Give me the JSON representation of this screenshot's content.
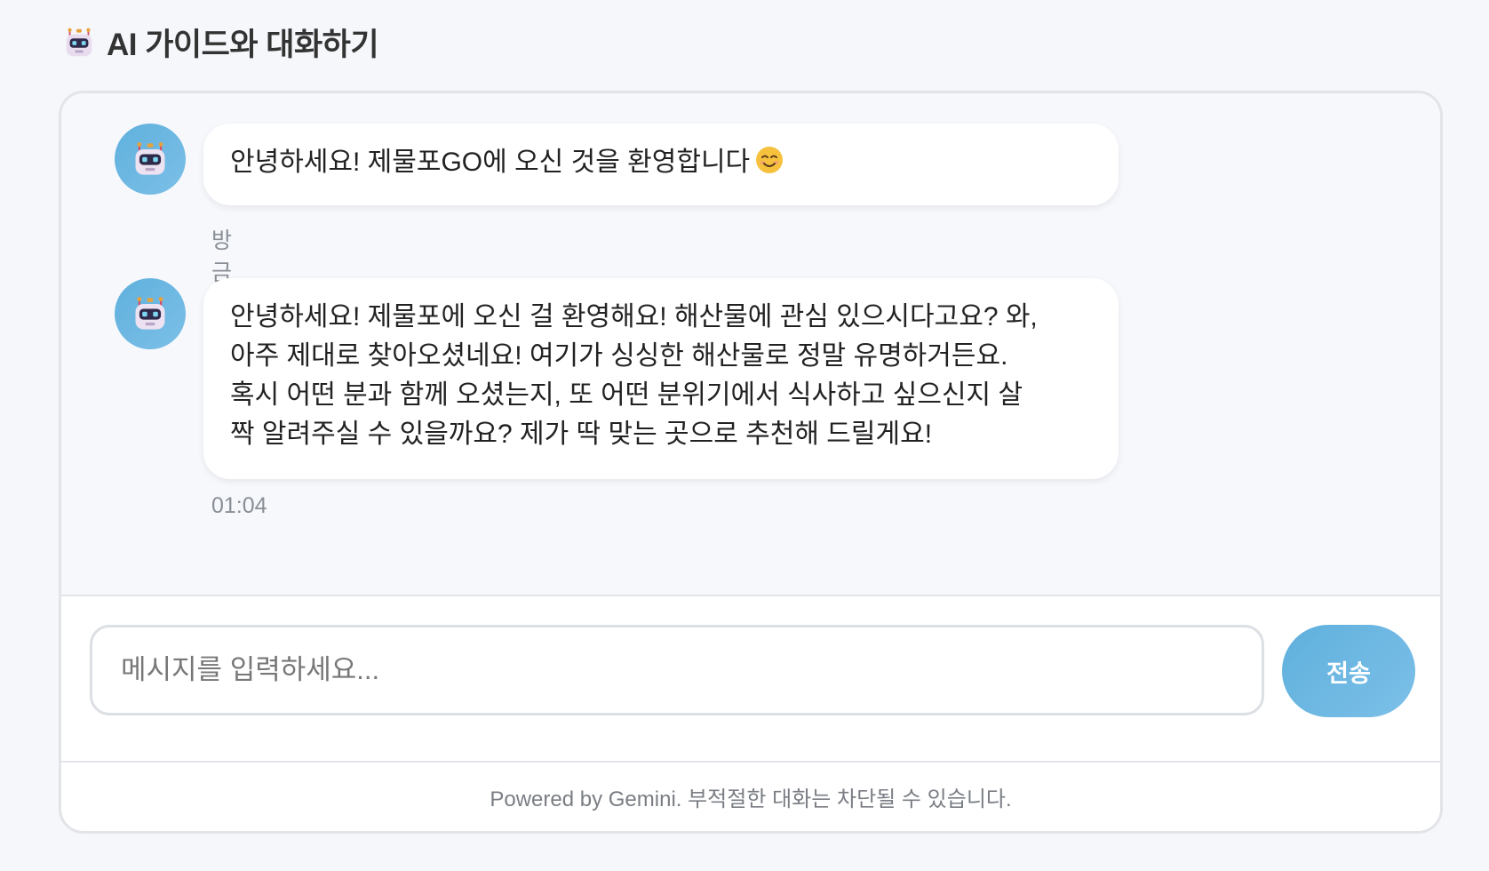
{
  "header": {
    "icon": "robot-icon",
    "title": "AI 가이드와 대화하기"
  },
  "messages": [
    {
      "sender": "bot",
      "avatar_icon": "robot-icon",
      "text": "안녕하세요! 제물포GO에 오신 것을 환영합니다",
      "emoji": "smiling-face-icon",
      "time": "방금 전"
    },
    {
      "sender": "bot",
      "avatar_icon": "robot-icon",
      "text": "안녕하세요! 제물포에 오신 걸 환영해요! 해산물에 관심 있으시다고요? 와,\n아주 제대로 찾아오셨네요! 여기가 싱싱한 해산물로 정말 유명하거든요.\n혹시 어떤 분과 함께 오셨는지, 또 어떤 분위기에서 식사하고 싶으신지 살\n짝 알려주실 수 있을까요? 제가 딱 맞는 곳으로 추천해 드릴게요!",
      "time": "01:04"
    }
  ],
  "input": {
    "placeholder": "메시지를 입력하세요...",
    "value": ""
  },
  "send_button": {
    "label": "전송"
  },
  "footer": {
    "text": "Powered by Gemini. 부적절한 대화는 차단될 수 있습니다."
  },
  "colors": {
    "accent": "#6ab8e2",
    "background": "#f5f7fb",
    "bubble": "#ffffff"
  }
}
